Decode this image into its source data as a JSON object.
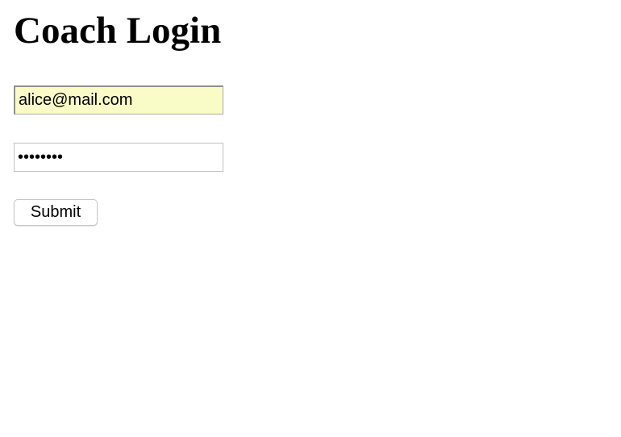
{
  "page": {
    "title": "Coach Login"
  },
  "form": {
    "email_value": "alice@mail.com",
    "password_value": "password",
    "submit_label": "Submit"
  },
  "colors": {
    "autofill_background": "#fafcc8",
    "page_background": "#ffffff"
  }
}
